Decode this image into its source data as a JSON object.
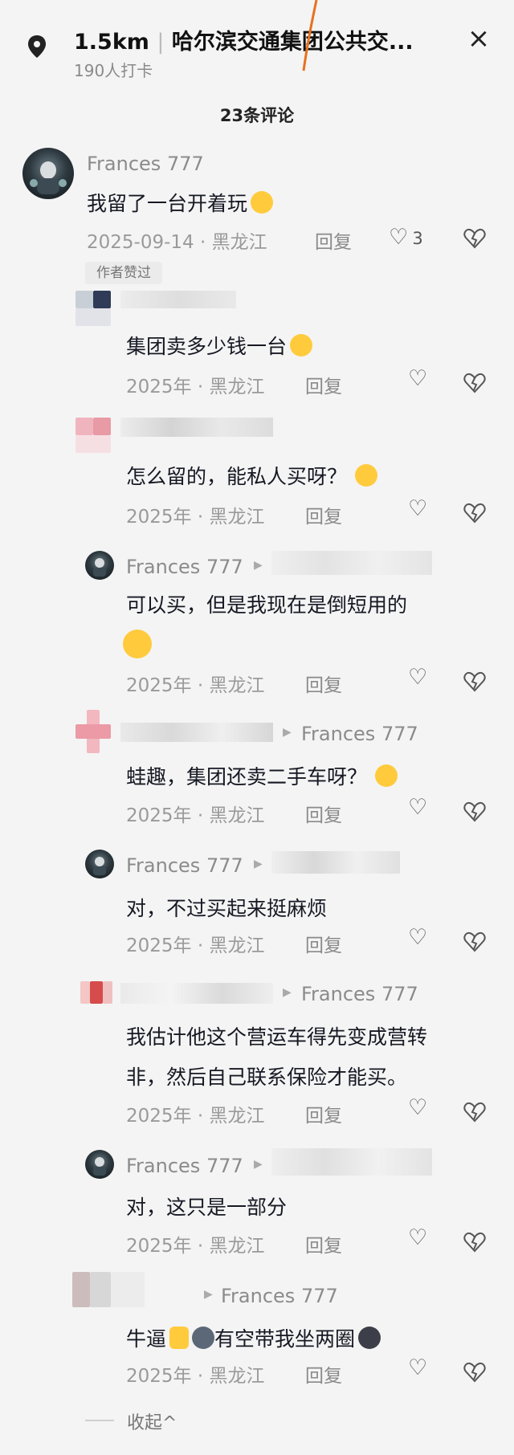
{
  "header": {
    "distance": "1.5km",
    "title": "哈尔滨交通集团公共交...",
    "checkins": "190人打卡",
    "close_symbol": "×"
  },
  "comments_title": "23条评论",
  "author_badge": "作者赞过",
  "collapse_label": "收起",
  "reply_label": "回复",
  "comments": [
    {
      "name": "Frances 777",
      "text": "我留了一台开着玩",
      "date": "2025-09-14 · 黑龙江",
      "likes": "3"
    },
    {
      "name": "",
      "text": "集团卖多少钱一台",
      "date": "2025年 · 黑龙江"
    },
    {
      "name": "",
      "text": "怎么留的，能私人买呀？",
      "date": "2025年 · 黑龙江"
    },
    {
      "name": "Frances 777",
      "text": "可以买，但是我现在是倒短用的",
      "date": "2025年 · 黑龙江"
    },
    {
      "name": "",
      "reply_to": "Frances 777",
      "text": "蛙趣，集团还卖二手车呀？",
      "date": "2025年 · 黑龙江"
    },
    {
      "name": "Frances 777",
      "text": "对，不过买起来挺麻烦",
      "date": "2025年 · 黑龙江"
    },
    {
      "name": "",
      "reply_to": "Frances 777",
      "text_line1": "我估计他这个营运车得先变成营转",
      "text_line2": "非，然后自己联系保险才能买。",
      "date": "2025年 · 黑龙江"
    },
    {
      "name": "Frances 777",
      "text": "对，这只是一部分",
      "date": "2025年 · 黑龙江"
    },
    {
      "name": "",
      "reply_to": "Frances 777",
      "text_a": "牛逼",
      "text_b": "有空带我坐两圈",
      "date": "2025年 · 黑龙江"
    }
  ],
  "colors": {
    "accent_orange": "#e8711e",
    "text": "#161823",
    "meta": "#9a9a9a"
  }
}
